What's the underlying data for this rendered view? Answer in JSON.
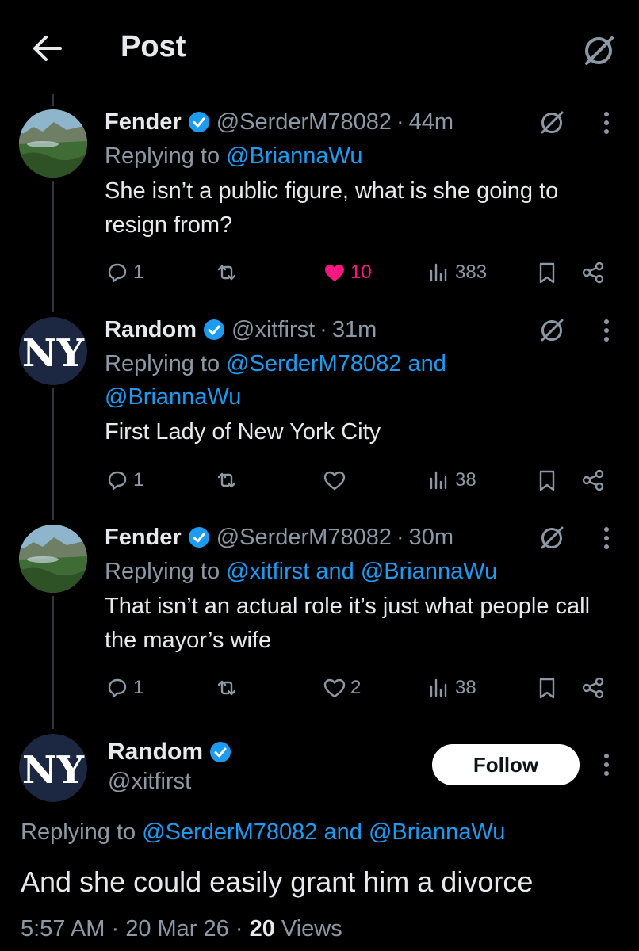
{
  "header": {
    "title": "Post",
    "back_icon": "arrow-left-icon",
    "grok_icon": "grok-icon"
  },
  "colors": {
    "background": "#000000",
    "text": "#e7e9ea",
    "muted": "#8b98a5",
    "accent": "#1d9bf0",
    "like": "#f91880",
    "verified": "#1d9bf0"
  },
  "replies": [
    {
      "name": "Fender",
      "handle": "@SerderM78082",
      "separator": "·",
      "time": "44m",
      "replying_prefix": "Replying to",
      "replying_to": "@BriannaWu",
      "replying_and": "",
      "replying_to_2": "",
      "text": "She isn’t a public figure, what is she going to resign from?",
      "replies": "1",
      "reposts": "",
      "likes": "10",
      "views": "383",
      "liked": true
    },
    {
      "name": "Random",
      "handle": "@xitfirst",
      "separator": "·",
      "time": "31m",
      "replying_prefix": "Replying to",
      "replying_to": "@SerderM78082",
      "replying_and": "and",
      "replying_to_2": "@BriannaWu",
      "text": "First Lady of New York City",
      "replies": "1",
      "reposts": "",
      "likes": "",
      "views": "38",
      "liked": false
    },
    {
      "name": "Fender",
      "handle": "@SerderM78082",
      "separator": "·",
      "time": "30m",
      "replying_prefix": "Replying to",
      "replying_to": "@xitfirst",
      "replying_and": "and",
      "replying_to_2": "@BriannaWu",
      "text": "That isn’t an actual role it’s just what people call the mayor’s wife",
      "replies": "1",
      "reposts": "",
      "likes": "2",
      "views": "38",
      "liked": false
    }
  ],
  "main": {
    "name": "Random",
    "handle": "@xitfirst",
    "follow_label": "Follow",
    "replying_prefix": "Replying to",
    "replying_to": "@SerderM78082",
    "replying_and": "and",
    "replying_to_2": "@BriannaWu",
    "text": "And she could easily grant him a divorce",
    "time": "5:57 AM",
    "sep1": "·",
    "date": "20 Mar 26",
    "sep2": "·",
    "views_count": "20",
    "views_label": "Views"
  }
}
